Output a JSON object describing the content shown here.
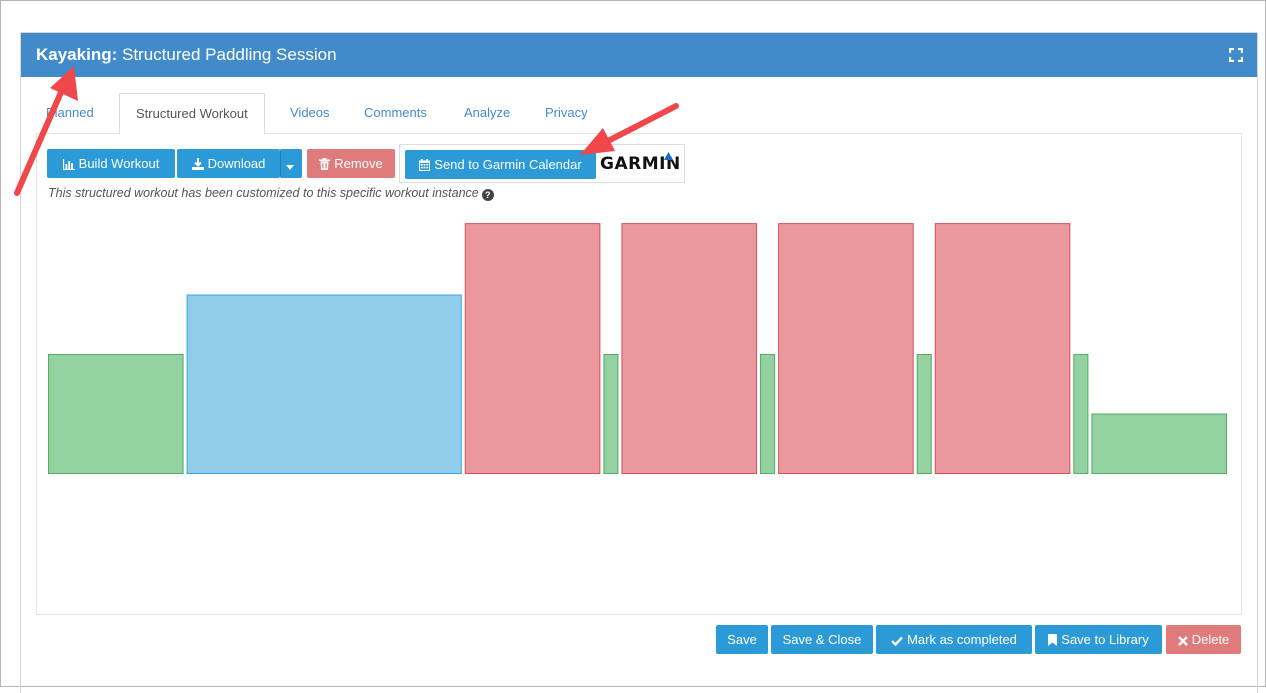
{
  "header": {
    "sport": "Kayaking",
    "separator": ":",
    "title": "Structured Paddling Session"
  },
  "tabs": [
    {
      "label": "Planned"
    },
    {
      "label": "Structured Workout"
    },
    {
      "label": "Videos"
    },
    {
      "label": "Comments"
    },
    {
      "label": "Analyze"
    },
    {
      "label": "Privacy"
    }
  ],
  "toolbar": {
    "build_label": "Build Workout",
    "download_label": "Download",
    "remove_label": "Remove",
    "garmin_send_label": "Send to Garmin Calendar",
    "garmin_logo": "GARMIN"
  },
  "note": "This structured workout has been customized to this specific workout instance",
  "colors": {
    "header": "#428bca",
    "button": "#2b9ad6",
    "danger": "#e07b7b",
    "zone_easy": "#93d2a0",
    "zone_moderate": "#90cdeb",
    "zone_hard": "#eb979e"
  },
  "chart_data": {
    "type": "bar",
    "title": "",
    "steps": [
      {
        "duration": 135,
        "intensity": 2,
        "zone": "easy"
      },
      {
        "duration": 274,
        "intensity": 3,
        "zone": "moderate"
      },
      {
        "duration": 135,
        "intensity": 4.2,
        "zone": "hard"
      },
      {
        "duration": 15,
        "intensity": 2,
        "zone": "easy"
      },
      {
        "duration": 135,
        "intensity": 4.2,
        "zone": "hard"
      },
      {
        "duration": 15,
        "intensity": 2,
        "zone": "easy"
      },
      {
        "duration": 135,
        "intensity": 4.2,
        "zone": "hard"
      },
      {
        "duration": 15,
        "intensity": 2,
        "zone": "easy"
      },
      {
        "duration": 135,
        "intensity": 4.2,
        "zone": "hard"
      },
      {
        "duration": 15,
        "intensity": 2,
        "zone": "easy"
      },
      {
        "duration": 135,
        "intensity": 1,
        "zone": "easy"
      }
    ]
  },
  "footer": {
    "save": "Save",
    "save_close": "Save & Close",
    "mark_completed": "Mark as completed",
    "save_library": "Save to Library",
    "delete": "Delete"
  }
}
